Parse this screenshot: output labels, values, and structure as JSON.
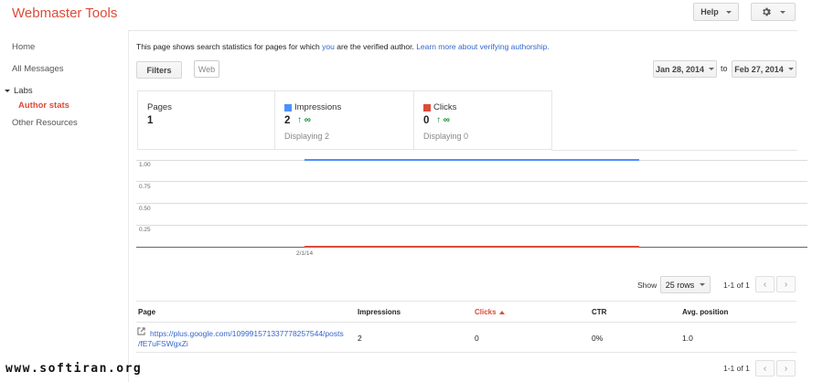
{
  "header": {
    "app_title": "Webmaster Tools",
    "help_label": "Help",
    "settings_icon": "gear-icon"
  },
  "sidebar": {
    "items": [
      {
        "label": "Home"
      },
      {
        "label": "All Messages"
      },
      {
        "label": "Labs"
      },
      {
        "label": "Author stats"
      },
      {
        "label": "Other Resources"
      }
    ]
  },
  "intro": {
    "text_before": "This page shows search statistics for pages for which ",
    "link_you": "you",
    "text_after": " are the verified author. ",
    "link_learn": "Learn more about verifying authorship."
  },
  "toolbar": {
    "filters_label": "Filters",
    "web_label": "Web",
    "date_from": "Jan 28, 2014",
    "date_to_word": "to",
    "date_to": "Feb 27, 2014"
  },
  "summary": {
    "pages": {
      "label": "Pages",
      "value": "1"
    },
    "impressions": {
      "label": "Impressions",
      "value": "2",
      "trend": "∞",
      "sub": "Displaying 2",
      "color": "#4d90fe"
    },
    "clicks": {
      "label": "Clicks",
      "value": "0",
      "trend": "∞",
      "sub": "Displaying 0",
      "color": "#dd4b39"
    }
  },
  "chart_data": {
    "type": "line",
    "y_ticks": [
      "1.00",
      "0.75",
      "0.50",
      "0.25"
    ],
    "ylim": [
      0,
      1
    ],
    "x_ticks": [
      "2/1/14"
    ],
    "series": [
      {
        "name": "Impressions",
        "color": "#4d90fe",
        "x_start": "2/1/14",
        "value": 1.0
      },
      {
        "name": "Clicks",
        "color": "#dd4b39",
        "x_start": "2/1/14",
        "value": 0
      }
    ]
  },
  "pager": {
    "show_label": "Show",
    "rows_option": "25 rows",
    "range_text": "1-1 of 1",
    "prev_icon": "chevron-left-icon",
    "next_icon": "chevron-right-icon"
  },
  "table": {
    "columns": [
      "Page",
      "Impressions",
      "Clicks",
      "CTR",
      "Avg. position"
    ],
    "sort_column": "Clicks",
    "rows": [
      {
        "page_line1": "https://plus.google.com/109991571337778257544/posts",
        "page_line2": "/fE7uFSWgxZi",
        "impressions": "2",
        "clicks": "0",
        "ctr": "0%",
        "avg_position": "1.0"
      }
    ]
  },
  "watermark": "www.softiran.org"
}
